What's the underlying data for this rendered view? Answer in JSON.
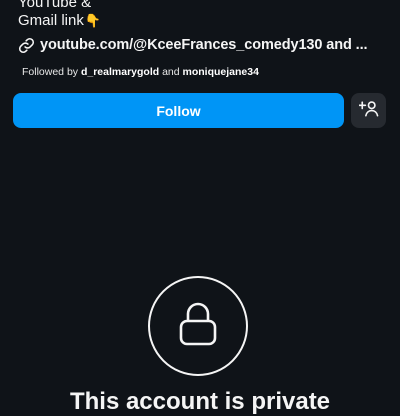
{
  "profile": {
    "bio_lines": [
      "YouTube &",
      "Gmail link"
    ],
    "bio_emoji": "👇",
    "bio_emoji_icon": "pointing-down-hand-icon",
    "link_icon": "link-icon",
    "link_text": "youtube.com/@KceeFrances_comedy130 and ...",
    "followed_by": {
      "prefix": "Followed by ",
      "user1": "d_realmarygold",
      "conjunction": " and ",
      "user2": "moniquejane34"
    }
  },
  "actions": {
    "follow_label": "Follow",
    "suggest_icon": "add-person-icon",
    "follow_color": "#0095f6"
  },
  "private": {
    "lock_icon": "lock-icon",
    "title": "This account is private"
  },
  "colors": {
    "background": "#0f1318",
    "secondary_button": "#262a30"
  }
}
